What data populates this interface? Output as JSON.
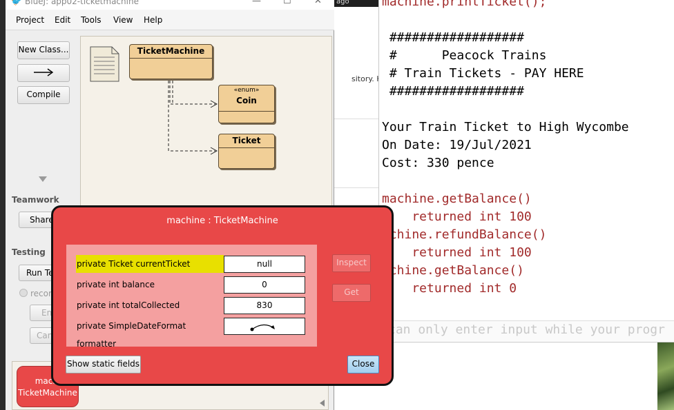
{
  "background": {
    "web_topbar": "ago",
    "web_snippet": "sitory. Here a"
  },
  "bluej": {
    "title": "BlueJ:  app02-ticketmachine",
    "menu": [
      "Project",
      "Edit",
      "Tools",
      "View",
      "Help"
    ],
    "buttons": {
      "new_class": "New Class...",
      "compile": "Compile",
      "share": "Share",
      "run_tests": "Run Te",
      "record": "recor",
      "end": "En",
      "cancel": "Can"
    },
    "sections": {
      "teamwork": "Teamwork",
      "testing": "Testing"
    },
    "classes": [
      {
        "name": "TicketMachine",
        "stereotype": ""
      },
      {
        "name": "Coin",
        "stereotype": "«enum»"
      },
      {
        "name": "Ticket",
        "stereotype": ""
      }
    ],
    "object_bench": {
      "label_line1": "machi",
      "label_line2": "TicketMachine"
    }
  },
  "terminal": {
    "lines": [
      {
        "text": "machine.printTicket();",
        "style": "red"
      },
      {
        "text": "",
        "style": ""
      },
      {
        "text": " ##################",
        "style": ""
      },
      {
        "text": " #      Peacock Trains",
        "style": ""
      },
      {
        "text": " # Train Tickets - PAY HERE",
        "style": ""
      },
      {
        "text": " ##################",
        "style": ""
      },
      {
        "text": "",
        "style": ""
      },
      {
        "text": "Your Train Ticket to High Wycombe",
        "style": ""
      },
      {
        "text": "On Date: 19/Jul/2021",
        "style": ""
      },
      {
        "text": "Cost: 330 pence",
        "style": ""
      },
      {
        "text": "",
        "style": ""
      },
      {
        "text": "machine.getBalance()",
        "style": "red"
      },
      {
        "text": "    returned int 100",
        "style": "red"
      },
      {
        "text": "achine.refundBalance()",
        "style": "red"
      },
      {
        "text": "    returned int 100",
        "style": "red"
      },
      {
        "text": "achine.getBalance()",
        "style": "red"
      },
      {
        "text": "    returned int 0",
        "style": "red"
      }
    ],
    "input_hint": "can only enter input while your progr"
  },
  "inspector": {
    "title": "machine : TicketMachine",
    "fields": [
      {
        "name": "private Ticket currentTicket",
        "value": "null",
        "selected": true
      },
      {
        "name": "private int balance",
        "value": "0",
        "selected": false
      },
      {
        "name": "private int totalCollected",
        "value": "830",
        "selected": false
      },
      {
        "name": "private SimpleDateFormat formatter",
        "value": "",
        "is_reference": true,
        "selected": false
      }
    ],
    "buttons": {
      "inspect": "Inspect",
      "get": "Get",
      "show_static": "Show static fields",
      "close": "Close"
    }
  }
}
